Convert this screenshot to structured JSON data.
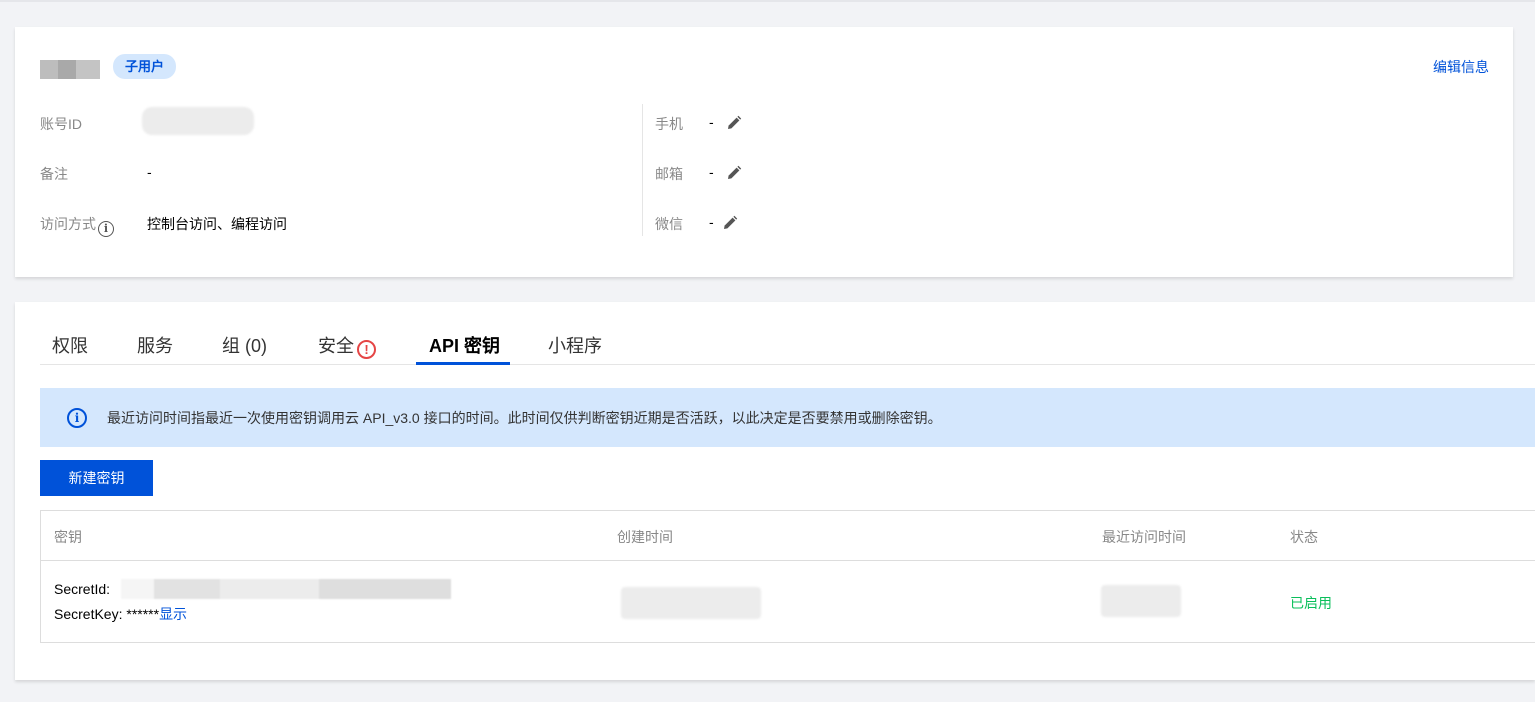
{
  "profile": {
    "badge": "子用户",
    "edit_link": "编辑信息",
    "account_id_label": "账号ID",
    "remark_label": "备注",
    "remark_value": "-",
    "access_label": "访问方式",
    "access_value": "控制台访问、编程访问",
    "phone_label": "手机",
    "phone_value": "-",
    "email_label": "邮箱",
    "email_value": "-",
    "wechat_label": "微信",
    "wechat_value": "-"
  },
  "tabs": [
    {
      "label": "权限"
    },
    {
      "label": "服务"
    },
    {
      "label": "组 (0)"
    },
    {
      "label": "安全"
    },
    {
      "label": "API 密钥"
    },
    {
      "label": "小程序"
    }
  ],
  "active_tab": "API 密钥",
  "notice": "最近访问时间指最近一次使用密钥调用云 API_v3.0 接口的时间。此时间仅供判断密钥近期是否活跃，以此决定是否要禁用或删除密钥。",
  "new_key_button": "新建密钥",
  "table": {
    "headers": {
      "key": "密钥",
      "created": "创建时间",
      "last_access": "最近访问时间",
      "status": "状态"
    },
    "rows": [
      {
        "secret_id_label": "SecretId:",
        "secret_key_label": "SecretKey: ******",
        "show_link": "显示",
        "status": "已启用"
      }
    ]
  },
  "colors": {
    "primary": "#0052d9",
    "badge_bg": "#d4e7fd",
    "status_green": "#0abf5b",
    "alert_red": "#e54545"
  }
}
